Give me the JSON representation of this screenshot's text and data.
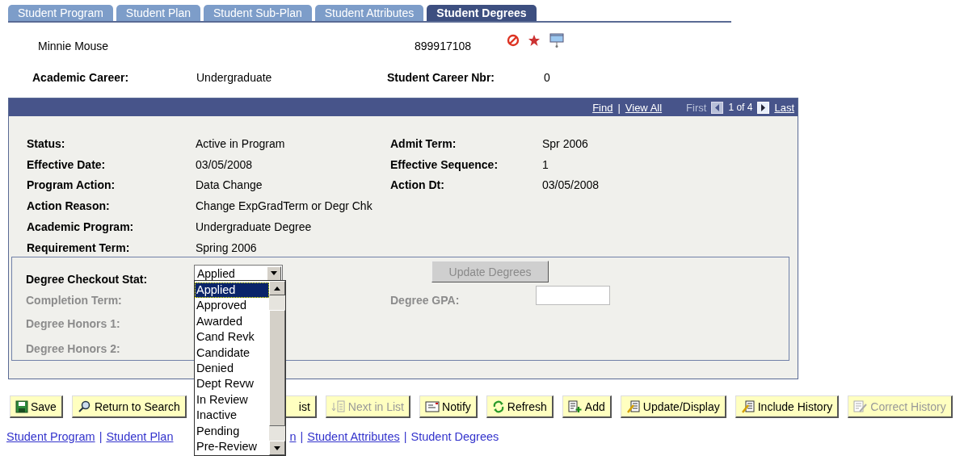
{
  "tabs": [
    {
      "label": "Student Program",
      "selected": false
    },
    {
      "label": "Student Plan",
      "selected": false
    },
    {
      "label": "Student Sub-Plan",
      "selected": false
    },
    {
      "label": "Student Attributes",
      "selected": false
    },
    {
      "label": "Student Degrees",
      "selected": true
    }
  ],
  "student": {
    "name": "Minnie Mouse",
    "id": "899917108"
  },
  "career": [
    {
      "label": "Academic Career:",
      "value": "Undergraduate"
    },
    {
      "label": "Student Career Nbr:",
      "value": "0"
    }
  ],
  "navigator": {
    "find": "Find",
    "separator": "|",
    "view_all": "View All",
    "first": "First",
    "position": "1 of 4",
    "last": "Last"
  },
  "fields": [
    {
      "label": "Status:",
      "value": "Active in Program",
      "label_2": "Admit Term:",
      "value_2": "Spr 2006"
    },
    {
      "label": "Effective Date:",
      "value": "03/05/2008",
      "label_2": "Effective Sequence:",
      "value_2": "1"
    },
    {
      "label": "Program Action:",
      "value": "Data Change",
      "label_2": "Action Dt:",
      "value_2": "03/05/2008"
    },
    {
      "label": "Action Reason:",
      "value": "Change ExpGradTerm or Degr Chk"
    },
    {
      "label": "Academic Program:",
      "value": "Undergraduate Degree"
    },
    {
      "label": "Requirement Term:",
      "value": "Spring 2006"
    }
  ],
  "degree": {
    "checkout_label": "Degree Checkout Stat:",
    "checkout_value": "Applied",
    "expanded": true,
    "options": [
      {
        "label": "Applied",
        "selected": true
      },
      {
        "label": "Approved",
        "selected": false
      },
      {
        "label": "Awarded",
        "selected": false
      },
      {
        "label": "Cand Revk",
        "selected": false
      },
      {
        "label": "Candidate",
        "selected": false
      },
      {
        "label": "Denied",
        "selected": false
      },
      {
        "label": "Dept Revw",
        "selected": false
      },
      {
        "label": "In Review",
        "selected": false
      },
      {
        "label": "Inactive",
        "selected": false
      },
      {
        "label": "Pending",
        "selected": false
      },
      {
        "label": "Pre-Review",
        "selected": false
      }
    ],
    "update_button": {
      "label": "Update Degrees",
      "disabled": true
    },
    "completion_label": "Completion Term:",
    "honors_1_label": "Degree Honors 1:",
    "honors_2_label": "Degree Honors 2:",
    "gpa_label": "Degree GPA:",
    "disabled": true
  },
  "buttons": [
    {
      "label": "Save",
      "kind": "save",
      "disabled": false,
      "obscured": false
    },
    {
      "label": "Return to Search",
      "kind": "search",
      "disabled": false,
      "obscured": false
    },
    {
      "label": "ist",
      "kind": "plain",
      "disabled": false,
      "obscured": true
    },
    {
      "label": "Next in List",
      "kind": "next",
      "disabled": true,
      "obscured": false
    },
    {
      "label": "Notify",
      "kind": "notify",
      "disabled": false,
      "obscured": false
    },
    {
      "label": "Refresh",
      "kind": "refresh",
      "disabled": false,
      "obscured": false
    },
    {
      "label": "Add",
      "kind": "add",
      "disabled": false,
      "obscured": false
    },
    {
      "label": "Update/Display",
      "kind": "edit",
      "disabled": false,
      "obscured": false
    },
    {
      "label": "Include History",
      "kind": "edit",
      "disabled": false,
      "obscured": false
    },
    {
      "label": "Correct History",
      "kind": "correct",
      "disabled": true,
      "obscured": false
    }
  ],
  "link_separator": "|",
  "links": [
    {
      "label": "Student Program",
      "current": false,
      "obscured": false
    },
    {
      "label": "Student Plan",
      "current": false,
      "obscured": false
    },
    {
      "label": "n",
      "current": false,
      "obscured": true
    },
    {
      "label": "Student Attributes",
      "current": false,
      "obscured": false
    },
    {
      "label": "Student Degrees",
      "current": true,
      "obscured": false
    }
  ]
}
